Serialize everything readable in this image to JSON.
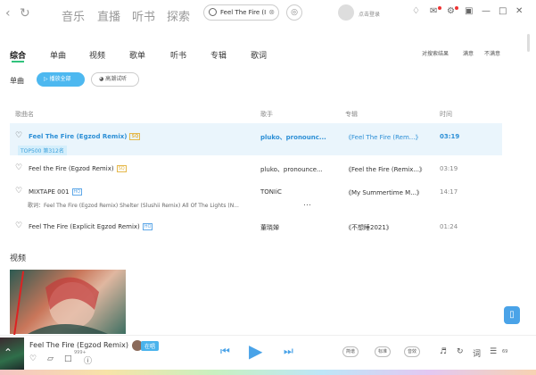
{
  "topbar": {
    "nav": [
      "音乐",
      "直播",
      "听书",
      "探索"
    ],
    "search_value": "Feel The Fire (I",
    "login_label": "点击登录"
  },
  "tabs": [
    "综合",
    "单曲",
    "视频",
    "歌单",
    "听书",
    "专辑",
    "歌词"
  ],
  "options": {
    "refine": "对搜索结果",
    "satisfied": "满意",
    "unsatisfied": "不满意"
  },
  "songs_section": {
    "label": "单曲",
    "play_all": "播放全部",
    "hq_preview": "高潮试听"
  },
  "table": {
    "headers": {
      "name": "歌曲名",
      "singer": "歌手",
      "album": "专辑",
      "time": "时间"
    },
    "rows": [
      {
        "title": "Feel The Fire (Egzod Remix)",
        "badge": "SQ",
        "singer": "pluko、pronounc...",
        "album": "《Feel The Fire (Rem...》",
        "time": "03:19",
        "rank": "TOP500 第312名"
      },
      {
        "title": "Feel the Fire (Egzod Remix)",
        "badge": "SQ",
        "singer": "pluko、pronounce...",
        "album": "《Feel the Fire (Remix...》",
        "time": "03:19"
      },
      {
        "title": "MIXTAPE 001",
        "badge": "HQ",
        "singer": "TONIiC",
        "album": "《My Summertime M...》",
        "time": "14:17",
        "lyric": "歌词：Feel The Fire (Egzod Remix) Shelter (Slushii Remix) All Of The Lights (N..."
      },
      {
        "title": "Feel The Fire (Explicit Egzod Remix)",
        "badge": "HQ",
        "singer": "董晓婵",
        "album": "《不想睡2021》",
        "time": "01:24"
      }
    ]
  },
  "video_section": {
    "label": "视频"
  },
  "player": {
    "title": "Feel The Fire (Egzod Remix)",
    "singing": "在唱",
    "comment_count": "999+",
    "pill_1": "简谱",
    "pill_2": "标准",
    "pill_3": "音效",
    "lyrics_btn": "词",
    "volume": "69"
  },
  "colors": {
    "accent": "#31c27c",
    "blue": "#4aa3e8",
    "highlight_row": "#eaf5fc"
  }
}
